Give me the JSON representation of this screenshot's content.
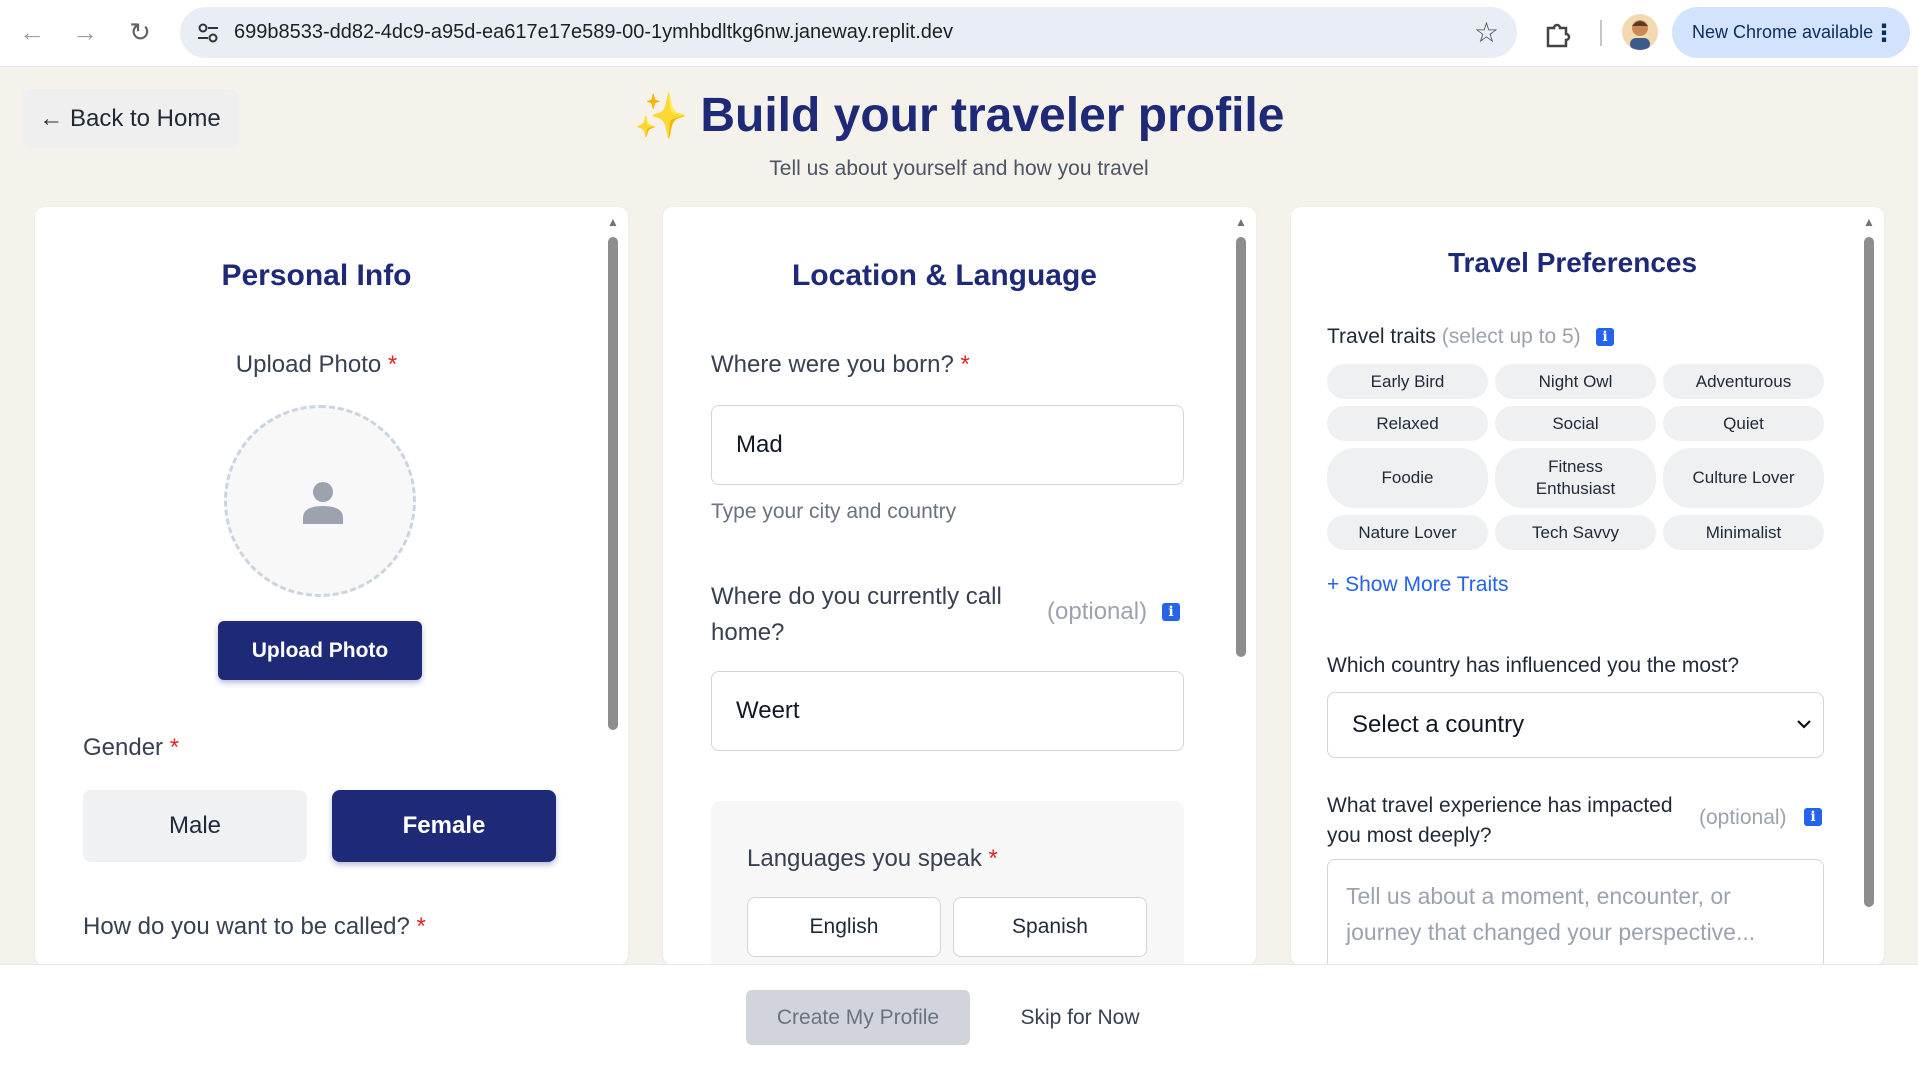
{
  "browser": {
    "url": "699b8533-dd82-4dc9-a95d-ea617e17e589-00-1ymhbdltkg6nw.janeway.replit.dev",
    "update_pill": "New Chrome available"
  },
  "header": {
    "back_label": "← Back to Home",
    "sparkle": "✨",
    "title": "Build your traveler profile",
    "subtitle": "Tell us about yourself and how you travel"
  },
  "personal": {
    "title": "Personal Info",
    "upload_label": "Upload Photo",
    "upload_button": "Upload Photo",
    "gender_label": "Gender",
    "gender_options": [
      "Male",
      "Female"
    ],
    "gender_selected": "Female",
    "called_label": "How do you want to be called?"
  },
  "location": {
    "title": "Location & Language",
    "born_label": "Where were you born?",
    "born_value": "Mad",
    "born_hint": "Type your city and country",
    "home_label": "Where do you currently call home?",
    "home_optional": "(optional)",
    "home_value": "Weert",
    "languages_label": "Languages you speak",
    "languages": [
      "English",
      "Spanish"
    ]
  },
  "preferences": {
    "title": "Travel Preferences",
    "traits_label": "Travel traits",
    "traits_sub": "(select up to 5)",
    "traits": [
      "Early Bird",
      "Night Owl",
      "Adventurous",
      "Relaxed",
      "Social",
      "Quiet",
      "Foodie",
      "Fitness Enthusiast",
      "Culture Lover",
      "Nature Lover",
      "Tech Savvy",
      "Minimalist"
    ],
    "more_traits": "+ Show More Traits",
    "influence_label": "Which country has influenced you the most?",
    "influence_value": "Select a country",
    "experience_label": "What travel experience has impacted you most deeply?",
    "experience_optional": "(optional)",
    "experience_placeholder": "Tell us about a moment, encounter, or journey that changed your perspective..."
  },
  "footer": {
    "create_label": "Create My Profile",
    "skip_label": "Skip for Now"
  },
  "colors": {
    "primary": "#1e2a78",
    "link": "#2563eb",
    "required": "#dc2626",
    "page_bg": "#f5f2ec"
  }
}
